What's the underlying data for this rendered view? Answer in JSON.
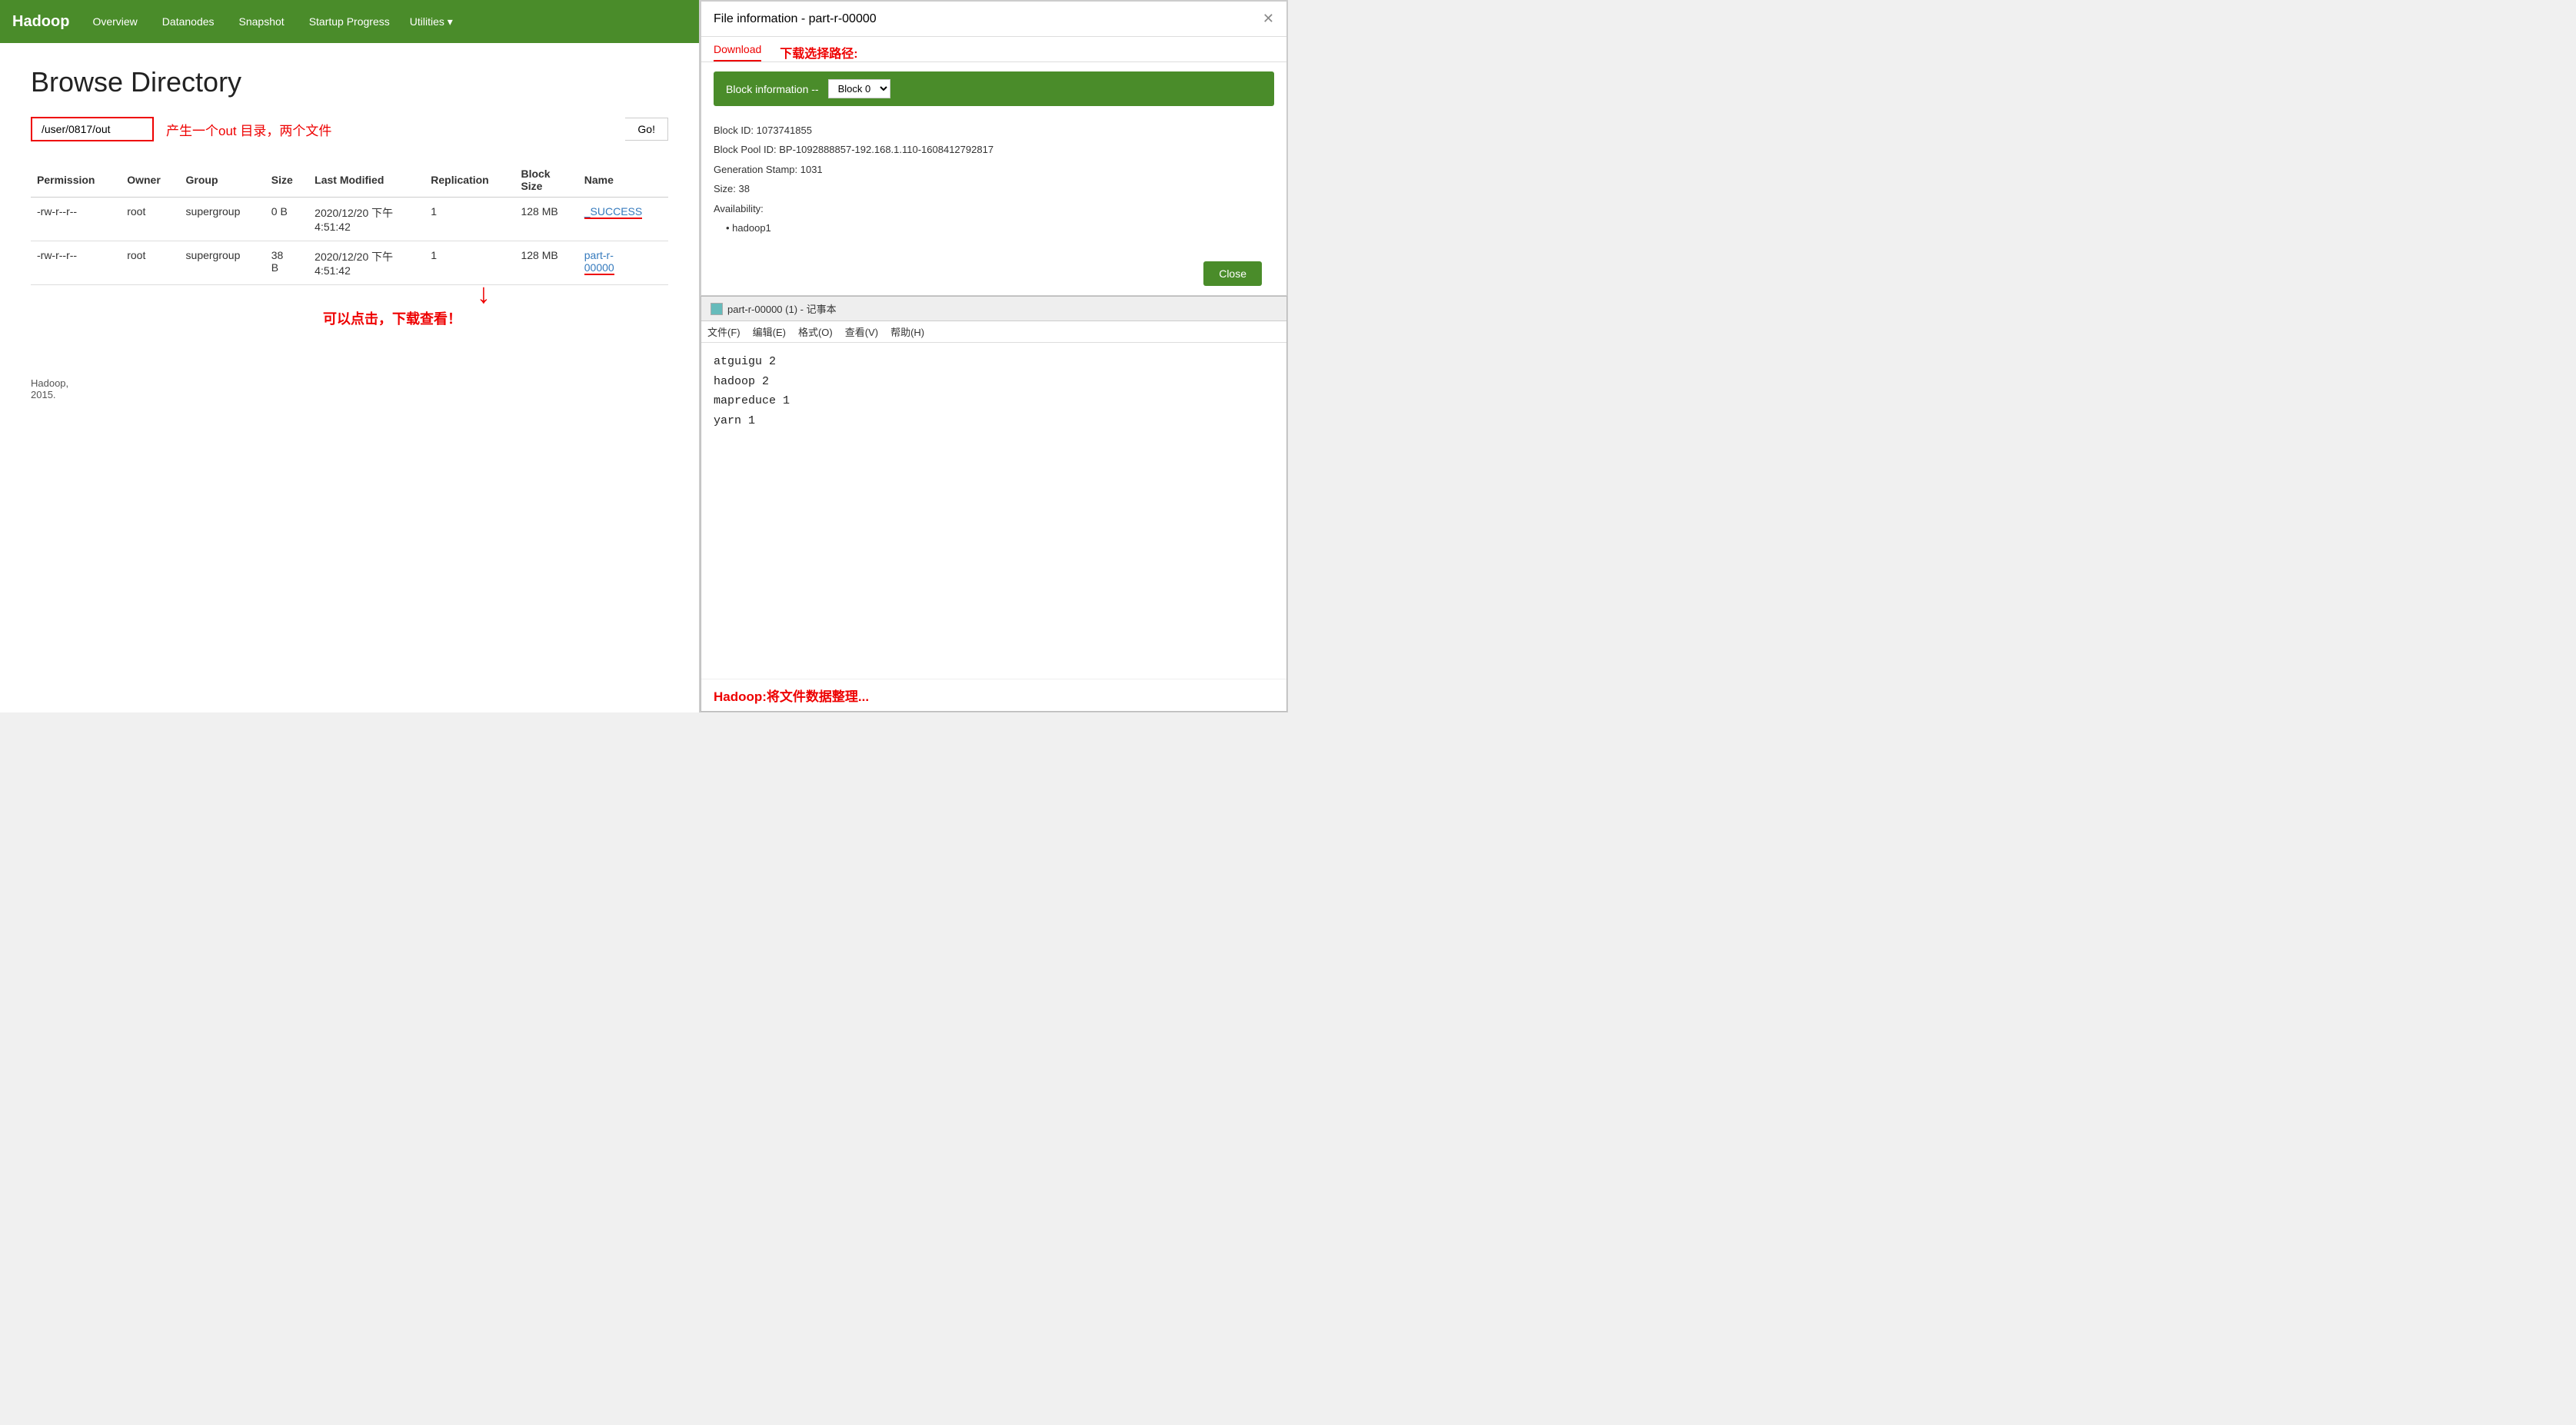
{
  "navbar": {
    "brand": "Hadoop",
    "items": [
      "Overview",
      "Datanodes",
      "Snapshot",
      "Startup Progress",
      "Utilities ▾"
    ]
  },
  "main": {
    "title": "Browse Directory",
    "dir_input_value": "/user/0817/out",
    "dir_annotation": "产生一个out 目录，两个文件",
    "go_button": "Go!",
    "table": {
      "headers": [
        "Permission",
        "Owner",
        "Group",
        "Size",
        "Last Modified",
        "Replication",
        "Block\nSize",
        "Name"
      ],
      "rows": [
        {
          "permission": "-rw-r--r--",
          "owner": "root",
          "group": "supergroup",
          "size": "0 B",
          "last_modified": "2020/12/20 下午\n4:51:42",
          "replication": "1",
          "block_size": "128 MB",
          "name": "_SUCCESS",
          "name_link": true
        },
        {
          "permission": "-rw-r--r--",
          "owner": "root",
          "group": "supergroup",
          "size": "38\nB",
          "last_modified": "2020/12/20 下午\n4:51:42",
          "replication": "1",
          "block_size": "128 MB",
          "name": "part-r-\n00000",
          "name_link": true
        }
      ]
    },
    "footer": "Hadoop,\n2015.",
    "annotation_arrow": "↓",
    "annotation_text": "可以点击，下载查看！"
  },
  "file_info": {
    "title": "File information - part-r-00000",
    "close_x": "✕",
    "tab_download": "Download",
    "tab_annotation": "下载选择路径:",
    "block_info_label": "Block information --",
    "block_select_value": "Block 0",
    "block_select_options": [
      "Block 0"
    ],
    "details": {
      "block_id": "Block ID: 1073741855",
      "block_pool_id": "Block Pool ID: BP-1092888857-192.168.1.110-1608412792817",
      "generation_stamp": "Generation Stamp: 1031",
      "size": "Size: 38",
      "availability_label": "Availability:",
      "availability_item": "hadoop1"
    },
    "close_button": "Close"
  },
  "notepad": {
    "title": "part-r-00000 (1) - 记事本",
    "icon_alt": "notepad-icon",
    "menu_items": [
      "文件(F)",
      "编辑(E)",
      "格式(O)",
      "查看(V)",
      "帮助(H)"
    ],
    "content_lines": [
      "atguigu  2",
      "hadoop   2",
      "mapreduce        1",
      "yarn     1"
    ],
    "footer_text": "Hadoop:将文件数据整理..."
  }
}
